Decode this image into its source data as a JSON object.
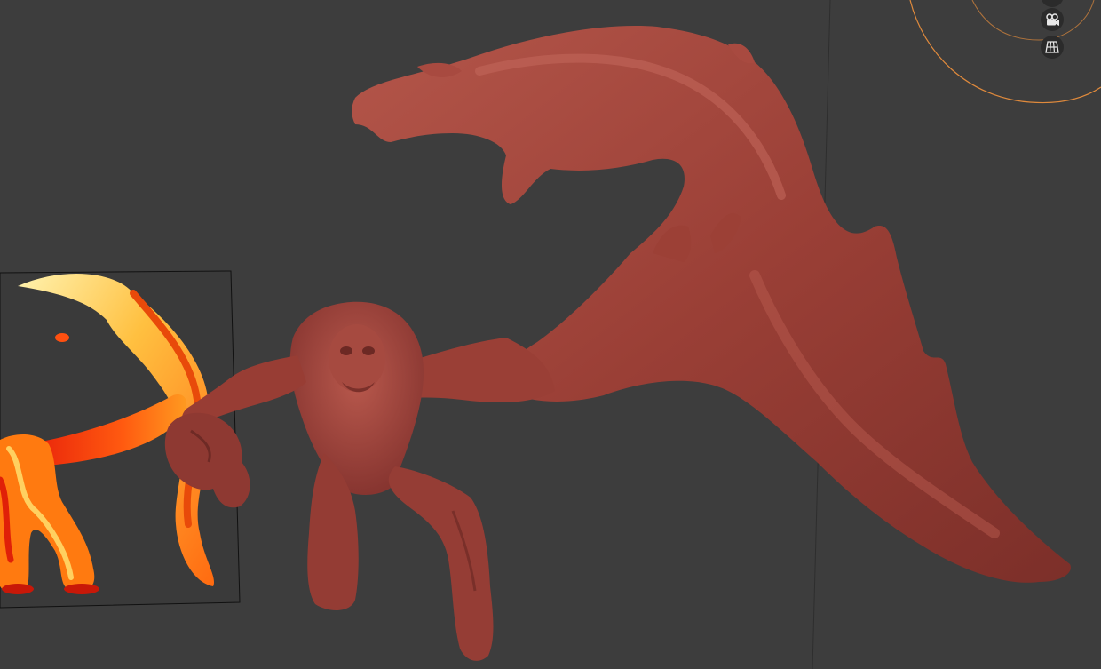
{
  "viewport": {
    "background_color": "#3d3d3d",
    "mesh_color": "#a0443a",
    "reference_image_colors": [
      "#f03a0a",
      "#ff7a10",
      "#ffd060",
      "#fff2b0"
    ],
    "gizmo_ring_color": "#e08a3c"
  },
  "navigation_gizmo": {
    "buttons": [
      {
        "icon": "camera-icon",
        "tooltip": ""
      },
      {
        "icon": "grid-icon",
        "tooltip": ""
      }
    ]
  }
}
